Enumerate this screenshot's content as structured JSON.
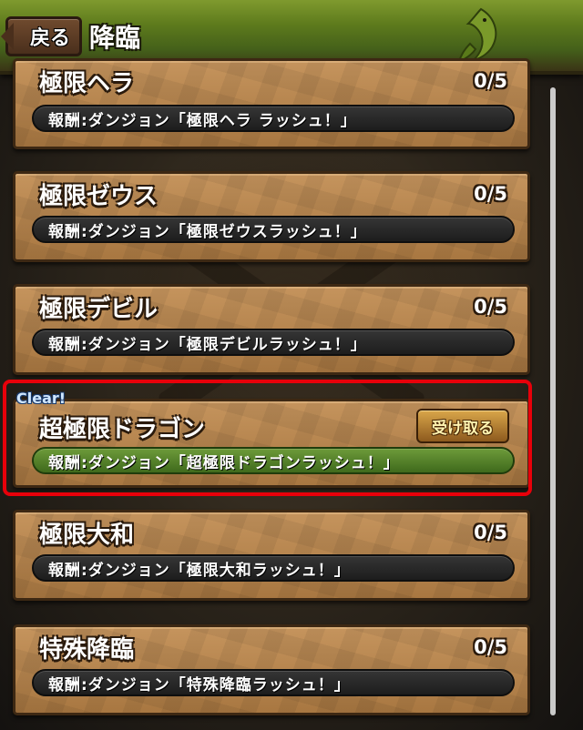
{
  "header": {
    "back_label": "戻る",
    "title": "降臨"
  },
  "missions": [
    {
      "title": "極限ヘラ",
      "count": "0/5",
      "reward": "報酬:ダンジョン「極限ヘラ ラッシュ！」",
      "cleared": false
    },
    {
      "title": "極限ゼウス",
      "count": "0/5",
      "reward": "報酬:ダンジョン「極限ゼウスラッシュ！」",
      "cleared": false
    },
    {
      "title": "極限デビル",
      "count": "0/5",
      "reward": "報酬:ダンジョン「極限デビルラッシュ！」",
      "cleared": false
    },
    {
      "title": "超極限ドラゴン",
      "badge": "Clear!",
      "button": "受け取る",
      "reward": "報酬:ダンジョン「超極限ドラゴンラッシュ！」",
      "cleared": true
    },
    {
      "title": "極限大和",
      "count": "0/5",
      "reward": "報酬:ダンジョン「極限大和ラッシュ！」",
      "cleared": false
    },
    {
      "title": "特殊降臨",
      "count": "0/5",
      "reward": "報酬:ダンジョン「特殊降臨ラッシュ！」",
      "cleared": false
    }
  ],
  "colors": {
    "header_green": "#5d7a1c",
    "card_stone": "#b98550",
    "highlight_red": "#e8000a",
    "reward_cleared": "#4f7f28"
  }
}
